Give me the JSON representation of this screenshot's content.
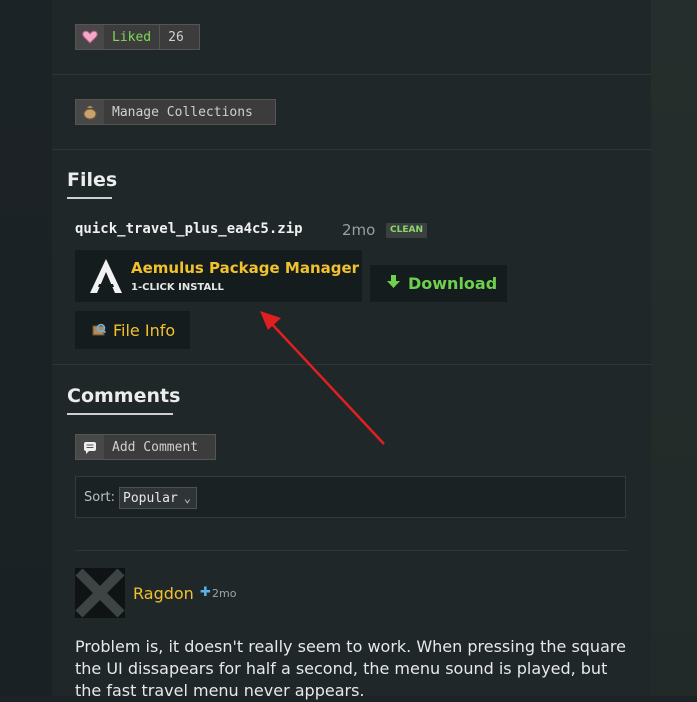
{
  "like": {
    "label": "Liked",
    "count": "26",
    "icon": "heart-icon"
  },
  "collections": {
    "label": "Manage Collections",
    "icon": "bag-icon"
  },
  "files": {
    "heading": "Files",
    "filename": "quick_travel_plus_ea4c5.zip",
    "age": "2mo",
    "badge": "CLEAN",
    "installer": {
      "title": "Aemulus Package Manager",
      "subtitle": "1-CLICK INSTALL"
    },
    "download_label": "Download",
    "file_info_label": "File Info"
  },
  "comments": {
    "heading": "Comments",
    "add_label": "Add Comment",
    "sort_label": "Sort:",
    "sort_value": "Popular",
    "items": [
      {
        "author": "Ragdon",
        "age": "2mo",
        "text": "Problem is, it doesn't really seem to work. When pressing the square the UI dissapears for half a second, the menu sound is played, but the fast travel menu never appears."
      }
    ]
  },
  "colors": {
    "accent": "#f2c12e",
    "download": "#6fcf4f",
    "liked": "#7ed957",
    "annotation": "#e02020"
  }
}
